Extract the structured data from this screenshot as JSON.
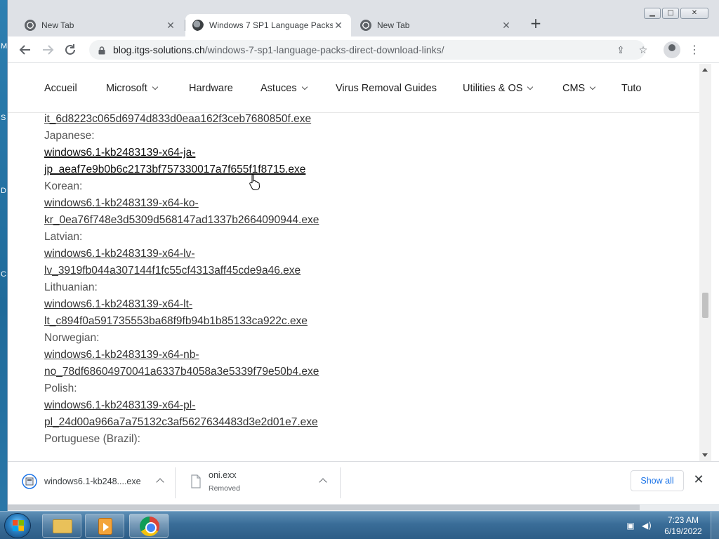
{
  "desktop": {
    "edge_letters": [
      "M",
      "S",
      "D",
      "C"
    ]
  },
  "tabs": [
    {
      "title": "New Tab",
      "favicon": "chrome-icon",
      "active": false
    },
    {
      "title": "Windows 7 SP1 Language Packs",
      "favicon": "site-icon",
      "active": true
    },
    {
      "title": "New Tab",
      "favicon": "chrome-icon",
      "active": false
    }
  ],
  "window_controls": {
    "minimize": "▁",
    "maximize": "□",
    "close": "✕"
  },
  "toolbar": {
    "url_host": "blog.itgs-solutions.ch",
    "url_path": "/windows-7-sp1-language-packs-direct-download-links/"
  },
  "site_nav": [
    {
      "label": "Accueil",
      "has_dropdown": false
    },
    {
      "label": "Microsoft",
      "has_dropdown": true
    },
    {
      "label": "Hardware",
      "has_dropdown": false
    },
    {
      "label": "Astuces",
      "has_dropdown": true
    },
    {
      "label": "Virus Removal Guides",
      "has_dropdown": false
    },
    {
      "label": "Utilities & OS",
      "has_dropdown": true
    },
    {
      "label": "CMS",
      "has_dropdown": true
    },
    {
      "label": "Tuto",
      "has_dropdown": false
    }
  ],
  "content": {
    "top_fragment": "it_6d8223c065d6974d833d0eaa162f3ceb7680850f.exe",
    "entries": [
      {
        "language": "Japanese:",
        "line1": "windows6.1-kb2483139-x64-ja-",
        "line2": "jp_aeaf7e9b0b6c2173bf757330017a7f655f1f8715.exe",
        "hovered": true
      },
      {
        "language": "Korean:",
        "line1": "windows6.1-kb2483139-x64-ko-",
        "line2": "kr_0ea76f748e3d5309d568147ad1337b2664090944.exe",
        "hovered": false
      },
      {
        "language": "Latvian:",
        "line1": "windows6.1-kb2483139-x64-lv-",
        "line2": "lv_3919fb044a307144f1fc55cf4313aff45cde9a46.exe",
        "hovered": false
      },
      {
        "language": "Lithuanian:",
        "line1": "windows6.1-kb2483139-x64-lt-",
        "line2": "lt_c894f0a591735553ba68f9fb94b1b85133ca922c.exe",
        "hovered": false
      },
      {
        "language": "Norwegian:",
        "line1": "windows6.1-kb2483139-x64-nb-",
        "line2": "no_78df68604970041a6337b4058a3e5339f79e50b4.exe",
        "hovered": false
      },
      {
        "language": "Polish:",
        "line1": "windows6.1-kb2483139-x64-pl-",
        "line2": "pl_24d00a966a7a75132c3af5627634483d3e2d01e7.exe",
        "hovered": false
      }
    ],
    "last_language": "Portuguese (Brazil):"
  },
  "downloads": [
    {
      "name": "windows6.1-kb248....exe",
      "status": ""
    },
    {
      "name": "oni.exx",
      "status": "Removed"
    }
  ],
  "shelf": {
    "show_all": "Show all",
    "close": "✕"
  },
  "taskbar": {
    "time": "7:23 AM",
    "date": "6/19/2022",
    "apps": [
      "windows-explorer",
      "windows-media-player",
      "google-chrome"
    ]
  },
  "colors": {
    "link": "#333333",
    "accent": "#1a73e8",
    "taskbar": "#3a6d98"
  }
}
